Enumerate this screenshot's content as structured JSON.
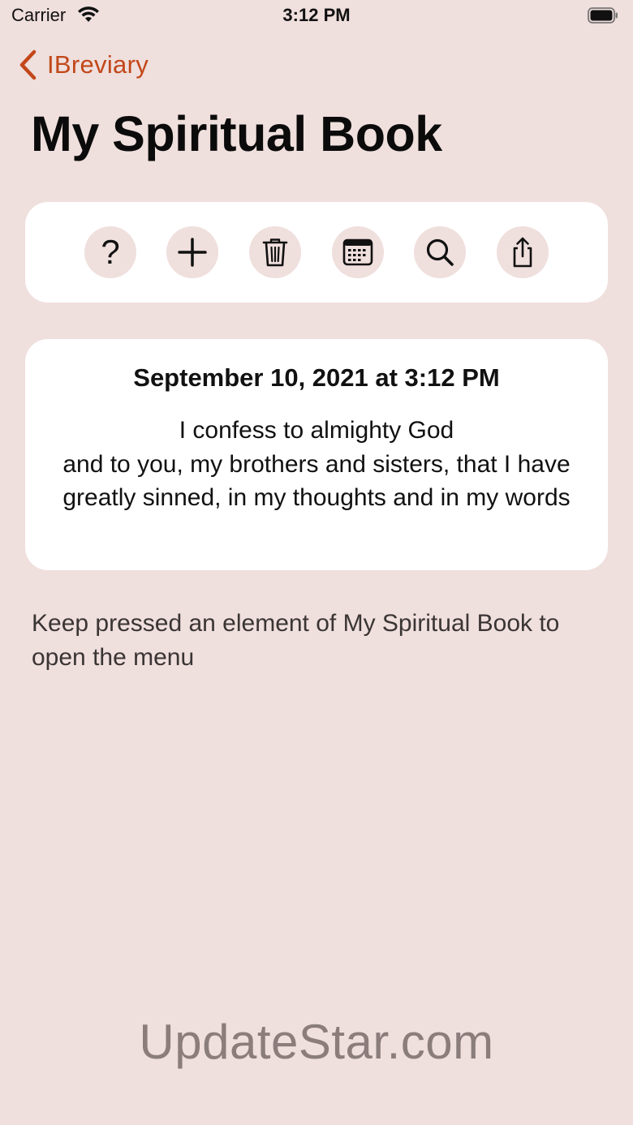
{
  "status_bar": {
    "carrier": "Carrier",
    "time": "3:12 PM",
    "icons": [
      "wifi-icon",
      "battery-icon"
    ]
  },
  "nav": {
    "back_label": "IBreviary",
    "back_icon": "chevron-left-icon"
  },
  "page": {
    "title": "My Spiritual Book"
  },
  "toolbar": {
    "buttons": [
      {
        "icon": "question-mark-icon",
        "glyph": "?"
      },
      {
        "icon": "plus-icon"
      },
      {
        "icon": "trash-icon"
      },
      {
        "icon": "calendar-icon"
      },
      {
        "icon": "search-icon"
      },
      {
        "icon": "share-icon"
      }
    ]
  },
  "entry": {
    "date": "September 10, 2021 at 3:12 PM",
    "text": "I confess to almighty God\nand to you, my brothers and sisters, that I have greatly sinned, in my thoughts and in my words"
  },
  "hint": {
    "text": "Keep pressed an element of My Spiritual Book to open the menu"
  },
  "watermark": {
    "text": "UpdateStar.com"
  },
  "colors": {
    "background": "#efdfdd",
    "card": "#ffffff",
    "accent": "#c24719",
    "button_bg": "#efdfdd"
  }
}
